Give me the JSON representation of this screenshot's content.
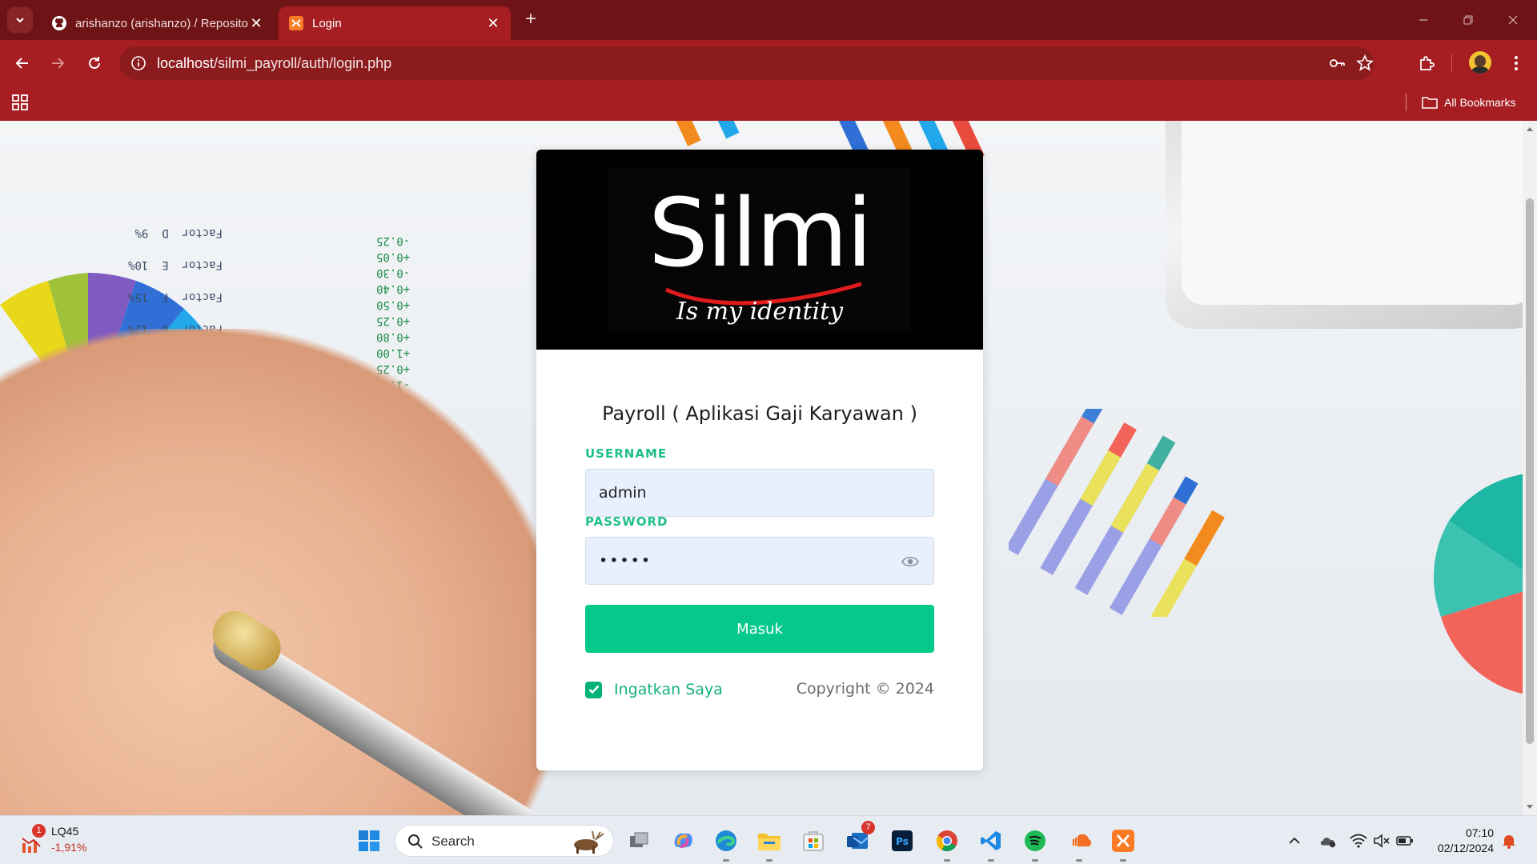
{
  "browser": {
    "tabs": [
      {
        "title": "arishanzo (arishanzo) / Repository",
        "icon": "github-icon",
        "active": false
      },
      {
        "title": "Login",
        "icon": "xampp-icon",
        "active": true
      }
    ],
    "url_host": "localhost",
    "url_path": "/silmi_payroll/auth/login.php",
    "bookmarks_label": "All Bookmarks"
  },
  "login": {
    "logo_text": "Silmi",
    "logo_tagline": "Is my identity",
    "title": "Payroll ( Aplikasi Gaji Karyawan )",
    "username_label": "USERNAME",
    "username_value": "admin",
    "password_label": "PASSWORD",
    "password_value": "•••••",
    "submit_label": "Masuk",
    "remember_label": "Ingatkan Saya",
    "remember_checked": true,
    "copyright": "Copyright © 2024"
  },
  "taskbar": {
    "widget_badge": "1",
    "widget_ticker": "LQ45",
    "widget_change": "-1,91%",
    "search_label": "Search",
    "store_badge": "7",
    "time": "07:10",
    "date": "02/12/2024"
  },
  "colors": {
    "chrome_dark": "#6e1416",
    "chrome": "#a61e22",
    "accent_green": "#05c98b",
    "label_green": "#1fbf85"
  }
}
